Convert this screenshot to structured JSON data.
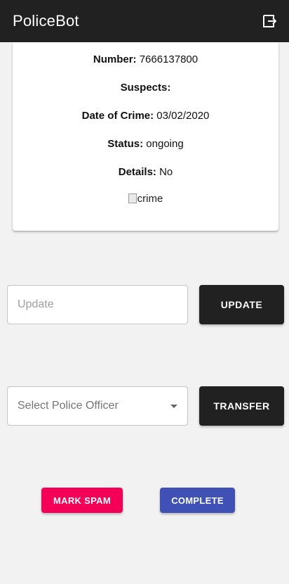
{
  "app": {
    "title": "PoliceBot",
    "logout_icon": "logout-icon"
  },
  "complaint": {
    "number_label": "Number:",
    "number_value": " 7666137800",
    "suspects_label": "Suspects:",
    "suspects_value": "",
    "date_label": "Date of Crime:",
    "date_value": " 03/02/2020",
    "status_label": "Status:",
    "status_value": " ongoing",
    "details_label": "Details:",
    "details_value": " No",
    "image_alt": "crime"
  },
  "update": {
    "placeholder": "Update",
    "value": "",
    "button_label": "UPDATE"
  },
  "transfer": {
    "select_placeholder": "Select Police Officer",
    "button_label": "TRANSFER"
  },
  "actions": {
    "mark_spam_label": "MARK SPAM",
    "complete_label": "COMPLETE"
  },
  "colors": {
    "appbar": "#212121",
    "background": "#f2f2f2",
    "dark_button": "#212121",
    "spam_button": "#f50057",
    "complete_button": "#3f51b5"
  }
}
